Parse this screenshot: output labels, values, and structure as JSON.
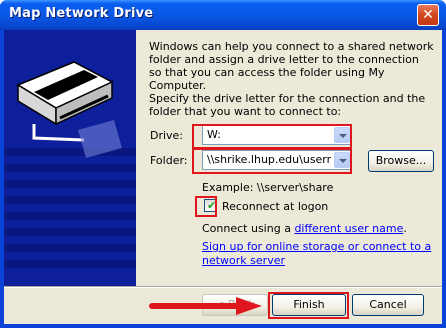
{
  "window": {
    "title": "Map Network Drive",
    "close_glyph": "✕"
  },
  "intro_text": "Windows can help you connect to a shared network folder and assign a drive letter to the connection so that you can access the folder using My Computer.",
  "instruction_text": "Specify the drive letter for the connection and the folder that you want to connect to:",
  "drive": {
    "label": "Drive:",
    "value": "W:"
  },
  "folder": {
    "label": "Folder:",
    "value": "\\\\shrike.lhup.edu\\usernam",
    "browse_label": "Browse..."
  },
  "example_text": "Example: \\\\server\\share",
  "reconnect": {
    "label": "Reconnect at logon",
    "checked": true
  },
  "connect_as": {
    "prefix": "Connect using a ",
    "link": "different user name",
    "suffix": "."
  },
  "signup_link": "Sign up for online storage or connect to a network server",
  "buttons": {
    "back": "< Back",
    "finish": "Finish",
    "cancel": "Cancel"
  },
  "colors": {
    "titlebar": "#0a58e6",
    "side_panel": "#0d1f9a",
    "dialog_bg": "#ece9d8",
    "annotation_red": "#e0161f",
    "link": "#0000ff"
  }
}
